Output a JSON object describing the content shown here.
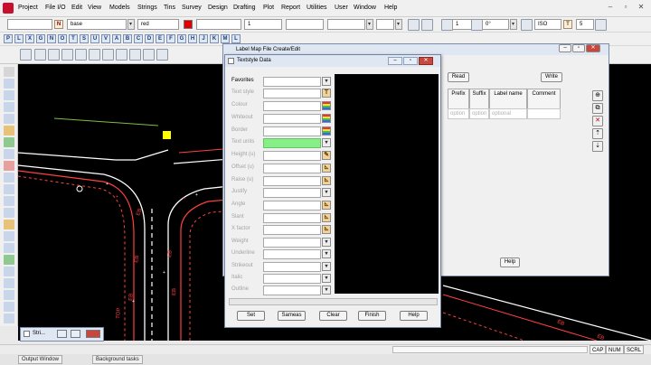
{
  "menubar": {
    "items": [
      "Project",
      "File I/O",
      "Edit",
      "View",
      "Models",
      "Strings",
      "Tins",
      "Survey",
      "Design",
      "Drafting",
      "Plot",
      "Report",
      "Utilities",
      "User",
      "Window",
      "Help"
    ]
  },
  "toolbar": {
    "n_label": "N",
    "model_value": "base",
    "colour_value": "red",
    "weight_value": "1",
    "num_value": "1",
    "angle_value": "0°",
    "style_value": "ISO",
    "t_label": "T",
    "size_value": "5",
    "letters": [
      "P",
      "L",
      "X",
      "G",
      "N",
      "O",
      "T",
      "S",
      "U",
      "V",
      "A",
      "B",
      "C",
      "D",
      "E",
      "F",
      "G",
      "H",
      "J",
      "K",
      "M",
      "L"
    ]
  },
  "back_dialog": {
    "title": "Label Map File Create/Edit",
    "read_label": "Read",
    "write_label": "Write",
    "help_label": "Help",
    "columns": [
      "Prefix",
      "Suffix",
      "Label name",
      "Comment"
    ],
    "row_placeholders": [
      "option",
      "option",
      "optional"
    ]
  },
  "dialog": {
    "title": "Textstyle Data",
    "rows": [
      {
        "label": "Favorites",
        "active": true,
        "icon": "dropdown-icon"
      },
      {
        "label": "Text style",
        "active": false,
        "icon": "text-style-icon"
      },
      {
        "label": "Colour",
        "active": false,
        "icon": "colour-icon"
      },
      {
        "label": "Whiteout",
        "active": false,
        "icon": "colour-icon"
      },
      {
        "label": "Border",
        "active": false,
        "icon": "colour-icon"
      },
      {
        "label": "Text units",
        "active": false,
        "icon": "dropdown-icon"
      },
      {
        "label": "Height (u)",
        "active": false,
        "icon": "pencil-icon"
      },
      {
        "label": "Offset (u)",
        "active": false,
        "icon": "pick-icon"
      },
      {
        "label": "Raise (u)",
        "active": false,
        "icon": "pick-icon"
      },
      {
        "label": "Justify",
        "active": false,
        "icon": "dropdown-icon"
      },
      {
        "label": "Angle",
        "active": false,
        "icon": "pick-icon"
      },
      {
        "label": "Slant",
        "active": false,
        "icon": "pick-icon"
      },
      {
        "label": "X factor",
        "active": false,
        "icon": "pick-icon"
      },
      {
        "label": "Weight",
        "active": false,
        "icon": "dropdown-icon"
      },
      {
        "label": "Underline",
        "active": false,
        "icon": "dropdown-icon"
      },
      {
        "label": "Strikeout",
        "active": false,
        "icon": "dropdown-icon"
      },
      {
        "label": "Italic",
        "active": false,
        "icon": "dropdown-icon"
      },
      {
        "label": "Outline",
        "active": false,
        "icon": "dropdown-icon"
      }
    ],
    "buttons": [
      "Set",
      "Sameas",
      "Clear",
      "Finish",
      "Help"
    ]
  },
  "strings_window": {
    "title": "Stri..."
  },
  "status": {
    "cap": "CAP",
    "num": "NUM",
    "scrl": "SCRL"
  },
  "bottom_tabs": [
    "Output Window",
    "Background tasks"
  ],
  "canvas_text": [
    "EB",
    "EB",
    "EB",
    "EB",
    "EB",
    "EB",
    "EB",
    "TOP"
  ]
}
